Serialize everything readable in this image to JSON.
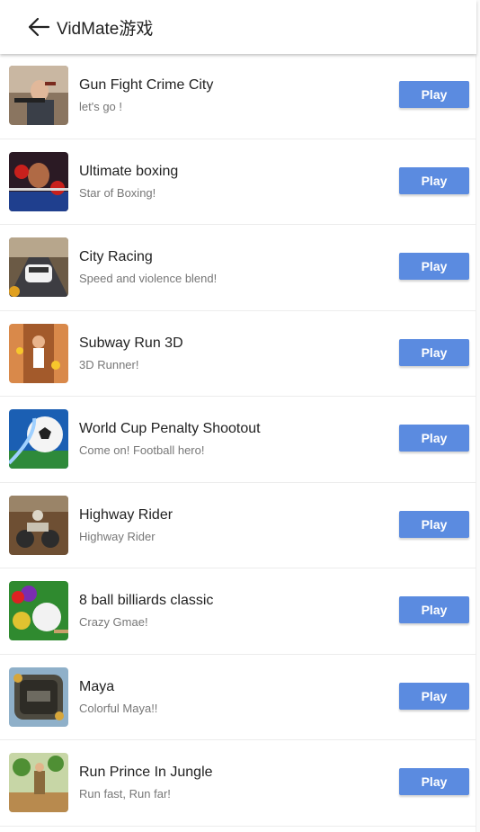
{
  "header": {
    "title": "VidMate游戏",
    "back_icon": "arrow-left-icon"
  },
  "colors": {
    "play_button": "#5b8be0",
    "divider": "#ececec"
  },
  "games": [
    {
      "name": "Gun Fight Crime City",
      "desc": "let's go !",
      "button": "Play",
      "thumb_icon": "gun-fight-thumbnail"
    },
    {
      "name": "Ultimate boxing",
      "desc": "Star of Boxing!",
      "button": "Play",
      "thumb_icon": "boxing-thumbnail"
    },
    {
      "name": "City Racing",
      "desc": "Speed and violence blend!",
      "button": "Play",
      "thumb_icon": "racing-car-thumbnail"
    },
    {
      "name": "Subway Run 3D",
      "desc": "3D Runner!",
      "button": "Play",
      "thumb_icon": "subway-run-thumbnail"
    },
    {
      "name": "World Cup Penalty Shootout",
      "desc": "Come on! Football hero!",
      "button": "Play",
      "thumb_icon": "soccer-ball-thumbnail"
    },
    {
      "name": "Highway Rider",
      "desc": "Highway Rider",
      "button": "Play",
      "thumb_icon": "motorbike-thumbnail"
    },
    {
      "name": "8 ball billiards classic",
      "desc": "Crazy Gmae!",
      "button": "Play",
      "thumb_icon": "billiards-thumbnail"
    },
    {
      "name": "Maya",
      "desc": "Colorful Maya!!",
      "button": "Play",
      "thumb_icon": "maya-stone-thumbnail"
    },
    {
      "name": "Run Prince In Jungle",
      "desc": "Run fast, Run far!",
      "button": "Play",
      "thumb_icon": "jungle-run-thumbnail"
    }
  ]
}
